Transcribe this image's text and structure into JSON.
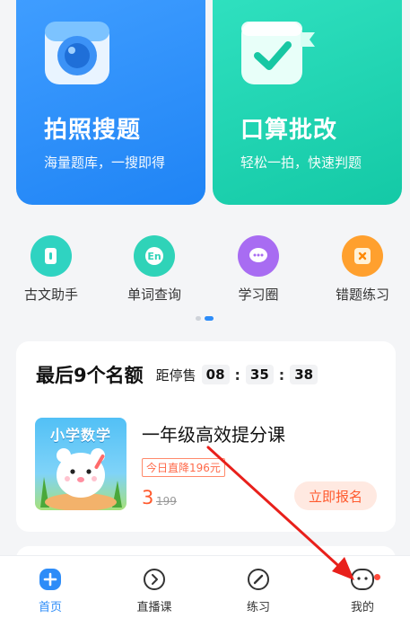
{
  "features": [
    {
      "title": "拍照搜题",
      "subtitle": "海量题库，一搜即得",
      "icon": "camera-icon"
    },
    {
      "title": "口算批改",
      "subtitle": "轻松一拍，快速判题",
      "icon": "checkmark-icon"
    }
  ],
  "tools": [
    {
      "label": "古文助手",
      "icon": "book-icon",
      "color": "#2fd3c1"
    },
    {
      "label": "单词查询",
      "icon": "en-icon",
      "color": "#2fd3b8"
    },
    {
      "label": "学习圈",
      "icon": "chat-icon",
      "color": "#a86cf2"
    },
    {
      "label": "错题练习",
      "icon": "wrong-icon",
      "color": "#ffa02e"
    }
  ],
  "course": {
    "header": "最后9个名额",
    "countdown_label": "距停售",
    "time": {
      "h": "08",
      "m": "35",
      "s": "38"
    },
    "thumb_title": "小学数学",
    "name": "一年级高效提分课",
    "promo": "今日直降196元",
    "price": "3",
    "old_price": "199",
    "button": "立即报名"
  },
  "tabbar": [
    {
      "label": "首页",
      "icon": "home-plus-icon",
      "active": true
    },
    {
      "label": "直播课",
      "icon": "play-circle-icon",
      "active": false
    },
    {
      "label": "练习",
      "icon": "pencil-circle-icon",
      "active": false
    },
    {
      "label": "我的",
      "icon": "profile-face-icon",
      "active": false
    }
  ],
  "colors": {
    "accent": "#2d8cf8",
    "price": "#ff5a2e"
  }
}
